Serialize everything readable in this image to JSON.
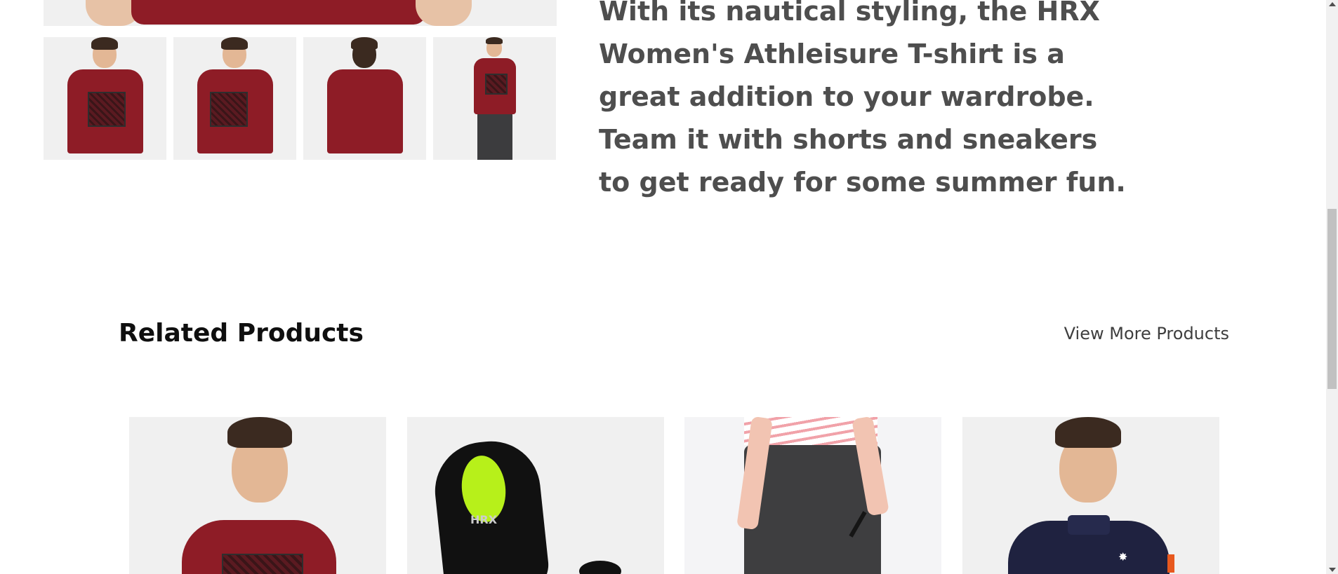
{
  "product": {
    "description": "With its nautical styling, the HRX Women's Athleisure T-shirt is a great addition to your wardrobe. Team it with shorts and sneakers to get ready for some summer fun."
  },
  "related": {
    "title": "Related Products",
    "view_more": "View More Products"
  },
  "cards": [
    {
      "label": "Red T-shirt"
    },
    {
      "label": "Black Sneaker",
      "logo": "HRX"
    },
    {
      "label": "Grey Track Pants"
    },
    {
      "label": "Navy Polo"
    }
  ],
  "colors": {
    "shirt_red": "#8e1c26",
    "text_dark": "#4e4e4e",
    "title_black": "#0f0f0f"
  }
}
